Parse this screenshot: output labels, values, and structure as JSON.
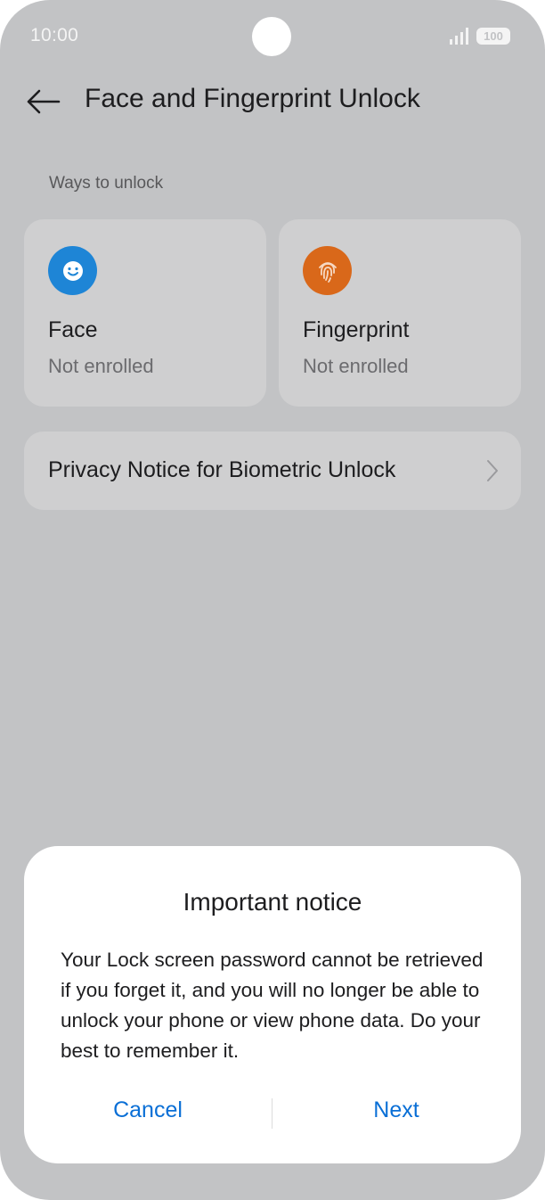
{
  "status_bar": {
    "time": "10:00",
    "battery": "100"
  },
  "header": {
    "title": "Face and Fingerprint Unlock"
  },
  "section": {
    "label": "Ways to unlock"
  },
  "cards": [
    {
      "title": "Face",
      "status": "Not enrolled",
      "icon": "face-smile-icon",
      "color": "#1e85d6"
    },
    {
      "title": "Fingerprint",
      "status": "Not enrolled",
      "icon": "fingerprint-icon",
      "color": "#d9681a"
    }
  ],
  "privacy": {
    "label": "Privacy Notice for Biometric Unlock"
  },
  "dialog": {
    "title": "Important notice",
    "body": "Your Lock screen password cannot be retrieved if you forget it, and you will no longer be able to unlock your phone or view phone data. Do your best to remember it.",
    "cancel_label": "Cancel",
    "next_label": "Next"
  },
  "colors": {
    "background": "#c2c3c5",
    "card": "#cfcfd0",
    "accent": "#0a6fd6"
  }
}
